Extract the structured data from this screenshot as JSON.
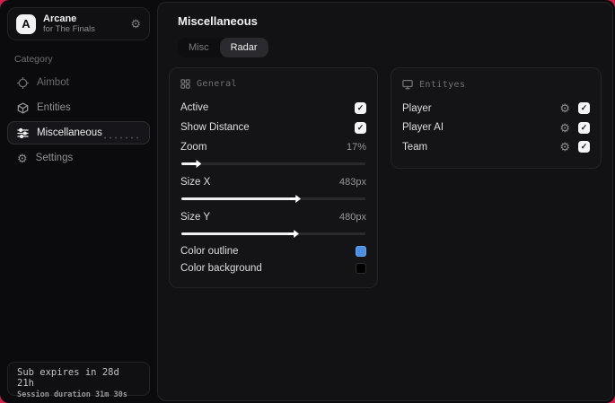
{
  "window": {
    "accent_bg": "#d6204c"
  },
  "sidebar": {
    "brand": {
      "logo_letter": "A",
      "name": "Arcane",
      "subtitle": "for The Finals"
    },
    "category_label": "Category",
    "items": [
      {
        "label": "Aimbot",
        "icon": "crosshair-icon",
        "active": false
      },
      {
        "label": "Entities",
        "icon": "cube-icon",
        "active": false
      },
      {
        "label": "Miscellaneous",
        "icon": "sliders-icon",
        "active": true
      },
      {
        "label": "Settings",
        "icon": "gear-icon",
        "active": false
      }
    ],
    "footer": {
      "line1": "Sub expires in 28d 21h",
      "line2": "Session duration 31m 30s"
    }
  },
  "main": {
    "title": "Miscellaneous",
    "tabs": [
      {
        "label": "Misc",
        "active": false
      },
      {
        "label": "Radar",
        "active": true
      }
    ],
    "panels": {
      "general": {
        "title": "General",
        "toggles": [
          {
            "label": "Active",
            "checked": true
          },
          {
            "label": "Show Distance",
            "checked": true
          }
        ],
        "sliders": [
          {
            "label": "Zoom",
            "value": "17%",
            "percent": 6
          },
          {
            "label": "Size X",
            "value": "483px",
            "percent": 60
          },
          {
            "label": "Size Y",
            "value": "480px",
            "percent": 59
          }
        ],
        "colors": [
          {
            "label": "Color outline",
            "color": "#4a8fe0"
          },
          {
            "label": "Color background",
            "color": "#000000"
          }
        ]
      },
      "entities": {
        "title": "Entityes",
        "rows": [
          {
            "label": "Player",
            "checked": true
          },
          {
            "label": "Player AI",
            "checked": true
          },
          {
            "label": "Team",
            "checked": true
          }
        ]
      }
    }
  },
  "icons": {
    "check": "✓",
    "gear": "⚙"
  }
}
